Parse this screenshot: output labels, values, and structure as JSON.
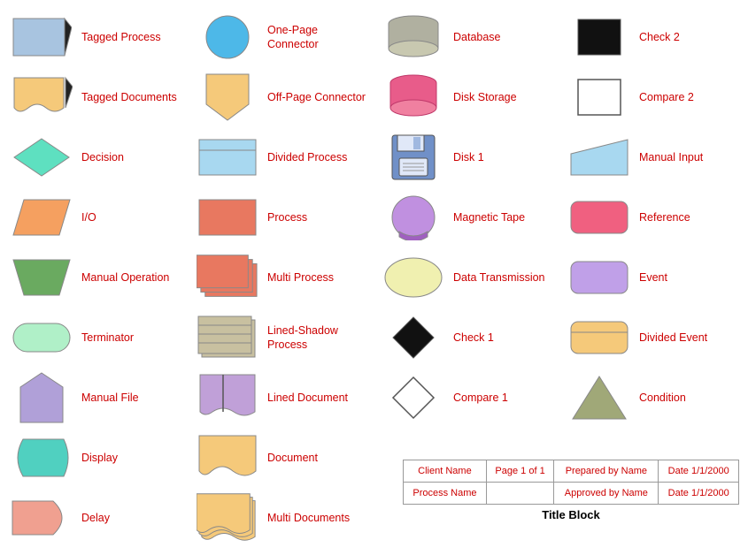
{
  "shapes": [
    {
      "id": "tagged-process",
      "label": "Tagged Process",
      "col": 0,
      "row": 0
    },
    {
      "id": "one-page-connector",
      "label": "One-Page Connector",
      "col": 1,
      "row": 0
    },
    {
      "id": "database",
      "label": "Database",
      "col": 2,
      "row": 0
    },
    {
      "id": "check2",
      "label": "Check 2",
      "col": 3,
      "row": 0
    },
    {
      "id": "tagged-documents",
      "label": "Tagged Documents",
      "col": 0,
      "row": 1
    },
    {
      "id": "off-page-connector",
      "label": "Off-Page Connector",
      "col": 1,
      "row": 1
    },
    {
      "id": "disk-storage",
      "label": "Disk Storage",
      "col": 2,
      "row": 1
    },
    {
      "id": "compare2",
      "label": "Compare 2",
      "col": 3,
      "row": 1
    },
    {
      "id": "decision",
      "label": "Decision",
      "col": 0,
      "row": 2
    },
    {
      "id": "divided-process",
      "label": "Divided Process",
      "col": 1,
      "row": 2
    },
    {
      "id": "disk1",
      "label": "Disk 1",
      "col": 2,
      "row": 2
    },
    {
      "id": "manual-input",
      "label": "Manual Input",
      "col": 3,
      "row": 2
    },
    {
      "id": "io",
      "label": "I/O",
      "col": 0,
      "row": 3
    },
    {
      "id": "process",
      "label": "Process",
      "col": 1,
      "row": 3
    },
    {
      "id": "magnetic-tape",
      "label": "Magnetic Tape",
      "col": 2,
      "row": 3
    },
    {
      "id": "reference",
      "label": "Reference",
      "col": 3,
      "row": 3
    },
    {
      "id": "manual-operation",
      "label": "Manual Operation",
      "col": 0,
      "row": 4
    },
    {
      "id": "multi-process",
      "label": "Multi Process",
      "col": 1,
      "row": 4
    },
    {
      "id": "data-transmission",
      "label": "Data Transmission",
      "col": 2,
      "row": 4
    },
    {
      "id": "event",
      "label": "Event",
      "col": 3,
      "row": 4
    },
    {
      "id": "terminator",
      "label": "Terminator",
      "col": 0,
      "row": 5
    },
    {
      "id": "lined-shadow-process",
      "label": "Lined-Shadow Process",
      "col": 1,
      "row": 5
    },
    {
      "id": "check1",
      "label": "Check 1",
      "col": 2,
      "row": 5
    },
    {
      "id": "divided-event",
      "label": "Divided Event",
      "col": 3,
      "row": 5
    },
    {
      "id": "manual-file",
      "label": "Manual File",
      "col": 0,
      "row": 6
    },
    {
      "id": "lined-document",
      "label": "Lined Document",
      "col": 1,
      "row": 6
    },
    {
      "id": "compare1",
      "label": "Compare 1",
      "col": 2,
      "row": 6
    },
    {
      "id": "condition",
      "label": "Condition",
      "col": 3,
      "row": 6
    },
    {
      "id": "display",
      "label": "Display",
      "col": 0,
      "row": 7
    },
    {
      "id": "document",
      "label": "Document",
      "col": 1,
      "row": 7
    },
    {
      "id": "delay",
      "label": "Delay",
      "col": 0,
      "row": 8
    },
    {
      "id": "multi-documents",
      "label": "Multi Documents",
      "col": 1,
      "row": 8
    }
  ],
  "title_block": {
    "row1": [
      "Client Name",
      "Page 1 of 1",
      "Prepared by Name",
      "Date 1/1/2000"
    ],
    "row2": [
      "Process Name",
      "",
      "Approved by Name",
      "Date 1/1/2000"
    ],
    "label": "Title Block"
  }
}
